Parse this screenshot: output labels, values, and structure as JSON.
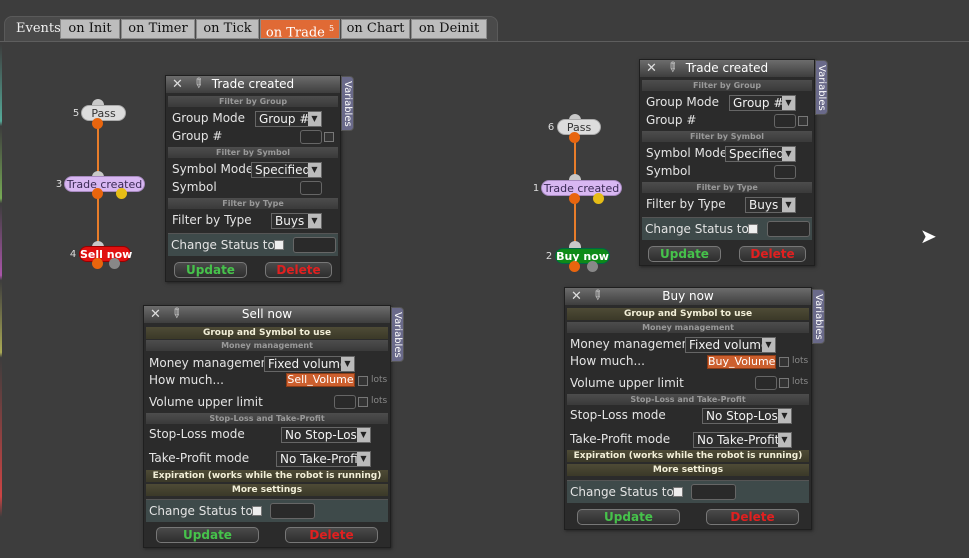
{
  "tabs": {
    "events_label": "Events",
    "items": [
      "on Init",
      "on Timer",
      "on Tick",
      "on Trade",
      "on Chart",
      "on Deinit"
    ],
    "active_badge": "5"
  },
  "graph_left": {
    "pass_num": "5",
    "pass_label": "Pass",
    "trade_num": "3",
    "trade_label": "Trade created",
    "action_num": "4",
    "action_label": "Sell now"
  },
  "graph_right": {
    "pass_num": "6",
    "pass_label": "Pass",
    "trade_num": "1",
    "trade_label": "Trade created",
    "action_num": "2",
    "action_label": "Buy now"
  },
  "trade_panel": {
    "title": "Trade created",
    "variables": "Variables",
    "filter_group": "Filter by Group",
    "group_mode_label": "Group Mode",
    "group_mode_value": "Group #",
    "group_num_label": "Group #",
    "filter_symbol": "Filter by Symbol",
    "symbol_mode_label": "Symbol Mode",
    "symbol_mode_value": "Specified",
    "symbol_label": "Symbol",
    "filter_type": "Filter by Type",
    "filter_type_label": "Filter by Type",
    "filter_type_value": "Buys",
    "change_status": "Change Status to",
    "update": "Update",
    "delete": "Delete"
  },
  "sell_panel": {
    "title": "Sell now",
    "variables": "Variables",
    "group_symbol": "Group and Symbol to use",
    "money_mgmt_hdr": "Money management",
    "money_mgmt_label": "Money management",
    "money_mgmt_value": "Fixed volume",
    "how_much_label": "How much...",
    "how_much_value": "Sell_Volume",
    "lots": "lots",
    "vol_upper_label": "Volume upper limit",
    "sltp_hdr": "Stop-Loss and Take-Profit",
    "sl_label": "Stop-Loss mode",
    "sl_value": "No Stop-Loss",
    "tp_label": "Take-Profit mode",
    "tp_value": "No Take-Profit",
    "expiration": "Expiration (works while the robot is running)",
    "more": "More settings",
    "change_status": "Change Status to",
    "update": "Update",
    "delete": "Delete"
  },
  "buy_panel": {
    "title": "Buy now",
    "variables": "Variables",
    "group_symbol": "Group and Symbol to use",
    "money_mgmt_hdr": "Money management",
    "money_mgmt_label": "Money management",
    "money_mgmt_value": "Fixed volume",
    "how_much_label": "How much...",
    "how_much_value": "Buy_Volume",
    "lots": "lots",
    "vol_upper_label": "Volume upper limit",
    "sltp_hdr": "Stop-Loss and Take-Profit",
    "sl_label": "Stop-Loss mode",
    "sl_value": "No Stop-Loss",
    "tp_label": "Take-Profit mode",
    "tp_value": "No Take-Profit",
    "expiration": "Expiration (works while the robot is running)",
    "more": "More settings",
    "change_status": "Change Status to",
    "update": "Update",
    "delete": "Delete"
  },
  "colors": {
    "accent": "#e06a35",
    "update": "#46c24b",
    "delete": "#e02020",
    "sell": "#e01010",
    "buy": "#0e8a18",
    "trade": "#d8b7f2"
  },
  "icons": {
    "close": "close-icon",
    "pin": "pin-icon",
    "cursor": "mouse-pointer-icon"
  }
}
